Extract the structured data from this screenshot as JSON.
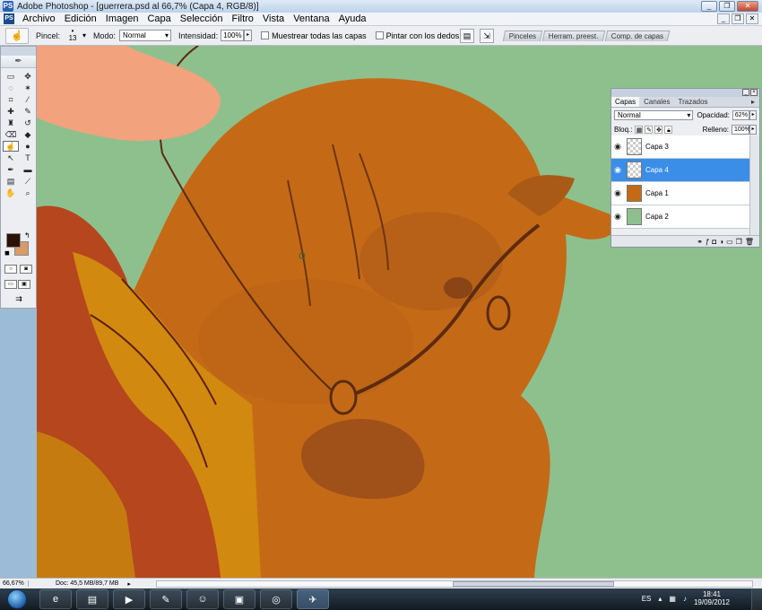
{
  "window": {
    "title": "Adobe Photoshop - [guerrera.psd al 66,7% (Capa 4, RGB/8)]",
    "app_icon": "PS",
    "controls": [
      "_",
      "❐",
      "✕"
    ]
  },
  "menubar": {
    "items": [
      "Archivo",
      "Edición",
      "Imagen",
      "Capa",
      "Selección",
      "Filtro",
      "Vista",
      "Ventana",
      "Ayuda"
    ],
    "doc_controls": [
      "_",
      "❐",
      "✕"
    ]
  },
  "options": {
    "brush_label": "Pincel:",
    "brush_size": "13",
    "mode_label": "Modo:",
    "mode_value": "Normal",
    "intensity_label": "Intensidad:",
    "intensity_value": "100%",
    "sample_all_layers": "Muestrear todas las capas",
    "finger_painting": "Pintar con los dedos",
    "wells": [
      "Pinceles",
      "Herram. preest.",
      "Comp. de capas"
    ]
  },
  "layers_panel": {
    "tabs": [
      "Capas",
      "Canales",
      "Trazados"
    ],
    "active_tab": "Capas",
    "blend_mode": "Normal",
    "opacity_label": "Opacidad:",
    "opacity_value": "62%",
    "lock_label": "Bloq.:",
    "fill_label": "Relleno:",
    "fill_value": "100%",
    "layers": [
      {
        "name": "Capa 3",
        "selected": false
      },
      {
        "name": "Capa 4",
        "selected": true
      },
      {
        "name": "Capa 1",
        "selected": false
      },
      {
        "name": "Capa 2",
        "selected": false
      }
    ]
  },
  "status": {
    "zoom": "66,67%",
    "doc": "Doc: 45,5 MB/89,7 MB"
  },
  "taskbar": {
    "language": "ES",
    "time": "18:41",
    "date": "19/09/2012"
  },
  "colors": {
    "foreground": "#2c1206",
    "background": "#d99b6a",
    "canvas_bg": "#8ec08e",
    "horse": "#c46a17",
    "selection": "#3a8ee8"
  }
}
